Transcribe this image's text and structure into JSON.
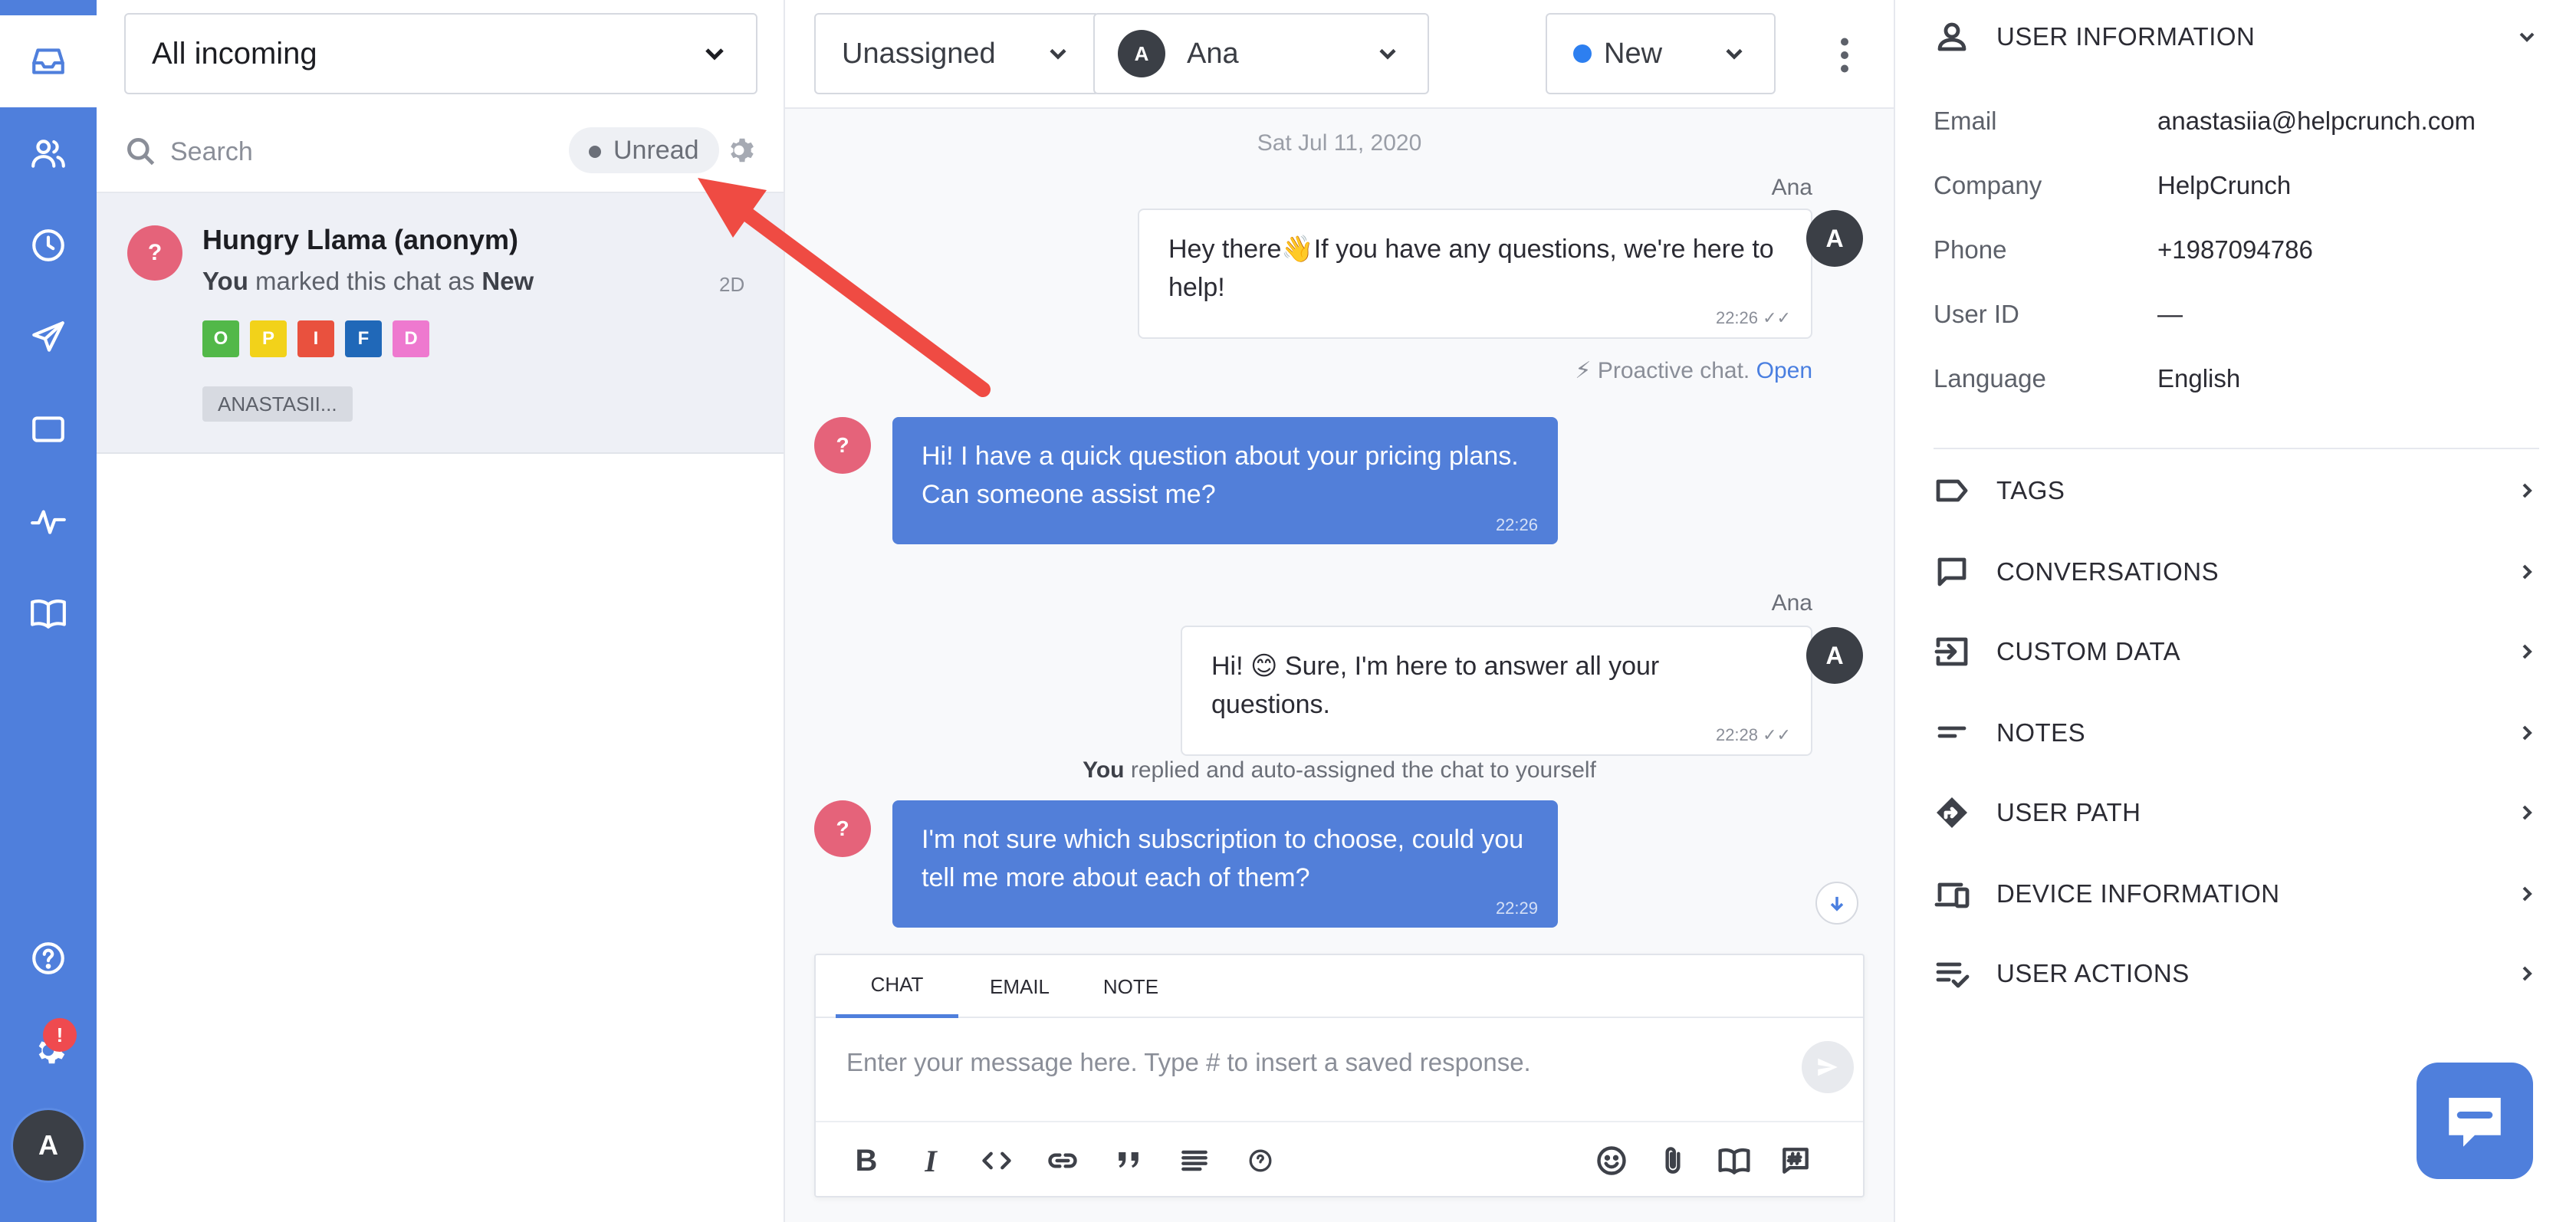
{
  "nav": {
    "items": [
      "inbox-icon",
      "users-icon",
      "clock-icon",
      "send-icon",
      "window-icon",
      "activity-icon",
      "book-icon"
    ],
    "help_icon": "help-circle-icon",
    "settings_badge": "!",
    "avatar_initial": "A"
  },
  "chat_list": {
    "filter_label": "All incoming",
    "search_placeholder": "Search",
    "unread_label": "Unread",
    "item": {
      "avatar": "?",
      "name": "Hungry Llama (anonym)",
      "preview_actor": "You",
      "preview_text": " marked this chat as ",
      "preview_status": "New",
      "time": "2D",
      "tags": [
        {
          "letter": "O",
          "color": "#52b849"
        },
        {
          "letter": "P",
          "color": "#f2d21a"
        },
        {
          "letter": "I",
          "color": "#e9513e"
        },
        {
          "letter": "F",
          "color": "#2068b8"
        },
        {
          "letter": "D",
          "color": "#ee79cf"
        }
      ],
      "agent": "ANASTASII..."
    }
  },
  "conversation": {
    "assignee_label": "Unassigned",
    "agent_initial": "A",
    "agent_name": "Ana",
    "status_label": "New",
    "date": "Sat Jul 11, 2020",
    "messages": [
      {
        "sender": "Ana",
        "avatar": "A",
        "text": "Hey there👋If you have any questions, we're here to help!",
        "time": "22:26"
      },
      {
        "avatar": "?",
        "text": "Hi! I have a quick question about your pricing plans. Can someone assist me?",
        "time": "22:26"
      },
      {
        "sender": "Ana",
        "avatar": "A",
        "text": "Hi! 😊 Sure, I'm here to answer all your questions.",
        "time": "22:28"
      },
      {
        "avatar": "?",
        "text": "I'm not sure which subscription to choose, could you tell me more about each of them?",
        "time": "22:29"
      }
    ],
    "proactive_text": "Proactive chat.",
    "proactive_link": "Open",
    "system_actor": "You",
    "system_text": " replied and auto-assigned the chat to yourself"
  },
  "composer": {
    "tabs": [
      "CHAT",
      "EMAIL",
      "NOTE"
    ],
    "placeholder": "Enter your message here. Type # to insert a saved response.",
    "bold_label": "B",
    "italic_label": "I"
  },
  "user_info": {
    "title": "USER INFORMATION",
    "fields": [
      {
        "label": "Email",
        "value": "anastasiia@helpcrunch.com"
      },
      {
        "label": "Company",
        "value": "HelpCrunch"
      },
      {
        "label": "Phone",
        "value": "+1987094786"
      },
      {
        "label": "User ID",
        "value": "—"
      },
      {
        "label": "Language",
        "value": "English"
      }
    ],
    "sections": [
      "TAGS",
      "CONVERSATIONS",
      "CUSTOM DATA",
      "NOTES",
      "USER PATH",
      "DEVICE INFORMATION",
      "USER ACTIONS"
    ]
  },
  "colors": {
    "brand": "#4f7fdc",
    "annotation_arrow": "#ef4b43"
  }
}
